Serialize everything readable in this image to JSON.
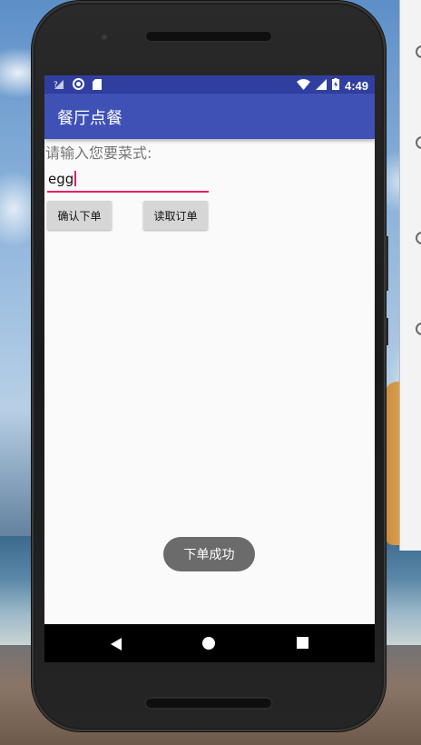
{
  "app": {
    "title": "餐厅点餐"
  },
  "status_bar": {
    "time": "4:49",
    "icons": [
      "no-sim-icon",
      "sync-circle-icon",
      "sd-card-icon",
      "wifi-icon",
      "signal-icon",
      "battery-charging-icon"
    ]
  },
  "form": {
    "prompt": "请输入您要菜式:",
    "dish_input_value": "egg",
    "confirm_button": "确认下单",
    "read_button": "读取订单"
  },
  "toast": {
    "message": "下单成功"
  },
  "navigation": {
    "icons": [
      "back-icon",
      "home-icon",
      "recents-icon"
    ]
  },
  "colors": {
    "status_bar": "#303f9f",
    "app_bar": "#3f51b5",
    "accent": "#e91e63",
    "button": "#d6d6d6",
    "toast": "#6b6b6b"
  }
}
